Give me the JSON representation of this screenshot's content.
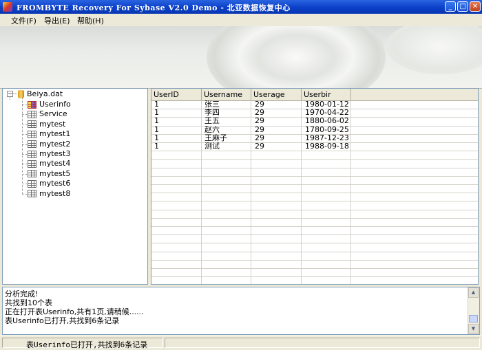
{
  "window": {
    "title": "FROMBYTE Recovery For Sybase V2.0 Demo - 北亚数据恢复中心"
  },
  "menu": [
    {
      "label": "文件(F)"
    },
    {
      "label": "导出(E)"
    },
    {
      "label": "帮助(H)"
    }
  ],
  "tree": {
    "root": "Beiya.dat",
    "expander": "−",
    "tables": [
      "Userinfo",
      "Service",
      "mytest",
      "mytest1",
      "mytest2",
      "mytest3",
      "mytest4",
      "mytest5",
      "mytest6",
      "mytest8"
    ]
  },
  "grid": {
    "columns": [
      "UserID",
      "Username",
      "Userage",
      "Userbir"
    ],
    "rows": [
      [
        "1",
        "张三",
        "29",
        "1980-01-12 ..."
      ],
      [
        "1",
        "李四",
        "29",
        "1970-04-22 ..."
      ],
      [
        "1",
        "王五",
        "29",
        "1880-06-02 ..."
      ],
      [
        "1",
        "赵六",
        "29",
        "1780-09-25 ..."
      ],
      [
        "1",
        "王麻子",
        "29",
        "1987-12-23 ..."
      ],
      [
        "1",
        "测试",
        "29",
        "1988-09-18 ..."
      ]
    ]
  },
  "log": [
    "分析完成!",
    "共找到10个表",
    "正在打开表Userinfo,共有1页,请稍候......",
    "表Userinfo已打开,共找到6条记录"
  ],
  "status": {
    "text": "表Userinfo已打开,共找到6条记录"
  },
  "icons": {
    "minimize": "_",
    "maximize": "□",
    "close": "✕",
    "scroll_up": "▲",
    "scroll_down": "▼"
  }
}
